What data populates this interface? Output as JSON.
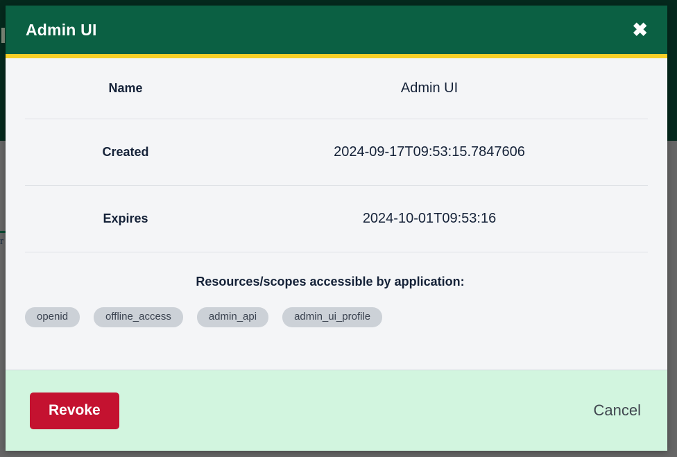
{
  "backdrop": {
    "color": "#666666",
    "nav_color": "#05291d",
    "artifact_glyph": "r"
  },
  "modal": {
    "header": {
      "title": "Admin UI",
      "close_label": "✖",
      "background": "#0b6043",
      "accent_color": "#f8cf27"
    },
    "details": [
      {
        "label": "Name",
        "value": "Admin UI"
      },
      {
        "label": "Created",
        "value": "2024-09-17T09:53:15.7847606"
      },
      {
        "label": "Expires",
        "value": "2024-10-01T09:53:16"
      }
    ],
    "scopes": {
      "heading": "Resources/scopes accessible by application:",
      "items": [
        "openid",
        "offline_access",
        "admin_api",
        "admin_ui_profile"
      ]
    },
    "footer": {
      "revoke_label": "Revoke",
      "cancel_label": "Cancel",
      "background": "#d2f5df",
      "revoke_color": "#c41230"
    }
  }
}
